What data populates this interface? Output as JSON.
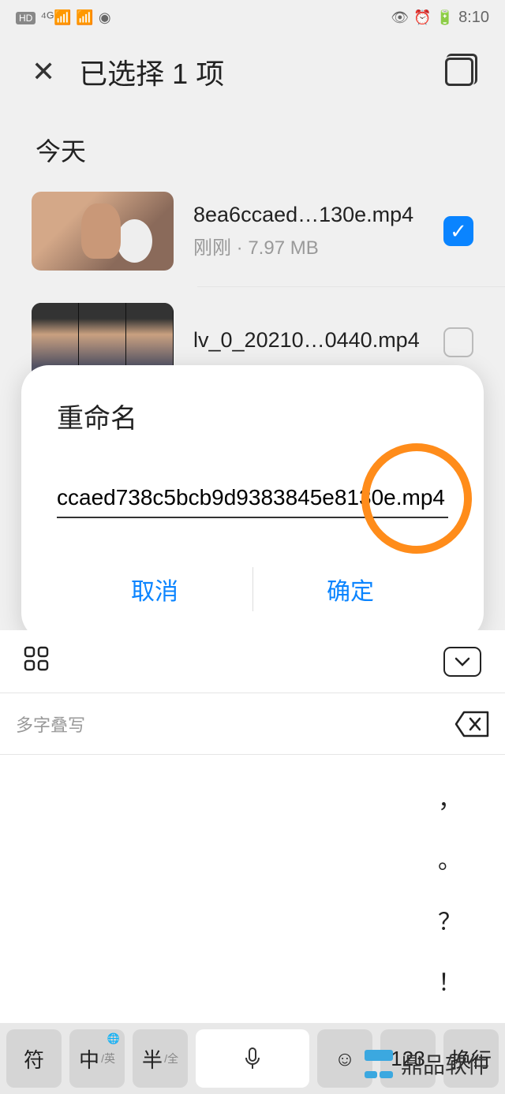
{
  "status": {
    "time": "8:10",
    "hd": "HD",
    "net": "4G"
  },
  "header": {
    "title": "已选择 1 项"
  },
  "section": {
    "today": "今天"
  },
  "files": [
    {
      "name": "8ea6ccaed…130e.mp4",
      "meta": "刚刚 · 7.97 MB",
      "checked": true
    },
    {
      "name": "lv_0_20210…0440.mp4",
      "meta": "",
      "checked": false
    }
  ],
  "modal": {
    "title": "重命名",
    "value": "ccaed738c5bcb9d9383845e8130e.mp4",
    "cancel": "取消",
    "confirm": "确定"
  },
  "keyboard": {
    "suggest": "多字叠写",
    "punct": [
      "，",
      "。",
      "？",
      "！"
    ],
    "keys": {
      "sym": "符",
      "zh": "中",
      "zh_sub": "/英",
      "half": "半",
      "half_sub": "/全",
      "num": "123",
      "enter": "换行"
    }
  },
  "watermark": "鼎品软件"
}
